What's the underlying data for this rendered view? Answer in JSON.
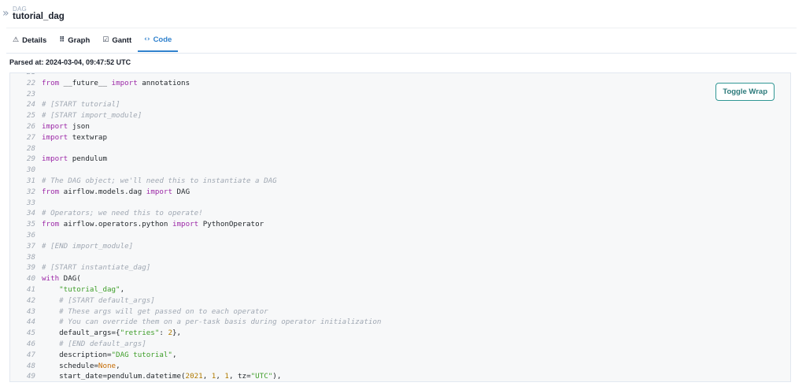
{
  "breadcrumb": {
    "type_label": "DAG",
    "title": "tutorial_dag"
  },
  "tabs": [
    {
      "icon": "⚠",
      "label": "Details",
      "active": false
    },
    {
      "icon": "⠿",
      "label": "Graph",
      "active": false
    },
    {
      "icon": "☑",
      "label": "Gantt",
      "active": false
    },
    {
      "icon": "‹›",
      "label": "Code",
      "active": true
    }
  ],
  "parsed_label": "Parsed at: 2024-03-04, 09:47:52 UTC",
  "toggle_wrap_label": "Toggle Wrap",
  "colors": {
    "accent": "#3182ce",
    "toggle": "#319795",
    "keyword": "#9d2aa8",
    "string": "#3f9e2a",
    "number": "#b07a00",
    "comment": "#a0a8b3"
  },
  "code": [
    {
      "n": "21",
      "tokens": []
    },
    {
      "n": "22",
      "tokens": [
        [
          "kw",
          "from"
        ],
        [
          "plain",
          " __future__ "
        ],
        [
          "kw",
          "import"
        ],
        [
          "plain",
          " annotations"
        ]
      ]
    },
    {
      "n": "23",
      "tokens": []
    },
    {
      "n": "24",
      "tokens": [
        [
          "comment",
          "# [START tutorial]"
        ]
      ]
    },
    {
      "n": "25",
      "tokens": [
        [
          "comment",
          "# [START import_module]"
        ]
      ]
    },
    {
      "n": "26",
      "tokens": [
        [
          "kw",
          "import"
        ],
        [
          "plain",
          " json"
        ]
      ]
    },
    {
      "n": "27",
      "tokens": [
        [
          "kw",
          "import"
        ],
        [
          "plain",
          " textwrap"
        ]
      ]
    },
    {
      "n": "28",
      "tokens": []
    },
    {
      "n": "29",
      "tokens": [
        [
          "kw",
          "import"
        ],
        [
          "plain",
          " pendulum"
        ]
      ]
    },
    {
      "n": "30",
      "tokens": []
    },
    {
      "n": "31",
      "tokens": [
        [
          "comment",
          "# The DAG object; we'll need this to instantiate a DAG"
        ]
      ]
    },
    {
      "n": "32",
      "tokens": [
        [
          "kw",
          "from"
        ],
        [
          "plain",
          " airflow.models.dag "
        ],
        [
          "kw",
          "import"
        ],
        [
          "plain",
          " DAG"
        ]
      ]
    },
    {
      "n": "33",
      "tokens": []
    },
    {
      "n": "34",
      "tokens": [
        [
          "comment",
          "# Operators; we need this to operate!"
        ]
      ]
    },
    {
      "n": "35",
      "tokens": [
        [
          "kw",
          "from"
        ],
        [
          "plain",
          " airflow.operators.python "
        ],
        [
          "kw",
          "import"
        ],
        [
          "plain",
          " PythonOperator"
        ]
      ]
    },
    {
      "n": "36",
      "tokens": []
    },
    {
      "n": "37",
      "tokens": [
        [
          "comment",
          "# [END import_module]"
        ]
      ]
    },
    {
      "n": "38",
      "tokens": []
    },
    {
      "n": "39",
      "tokens": [
        [
          "comment",
          "# [START instantiate_dag]"
        ]
      ]
    },
    {
      "n": "40",
      "tokens": [
        [
          "kw",
          "with"
        ],
        [
          "plain",
          " DAG("
        ]
      ]
    },
    {
      "n": "41",
      "tokens": [
        [
          "plain",
          "    "
        ],
        [
          "str",
          "\"tutorial_dag\""
        ],
        [
          "plain",
          ","
        ]
      ]
    },
    {
      "n": "42",
      "tokens": [
        [
          "plain",
          "    "
        ],
        [
          "comment",
          "# [START default_args]"
        ]
      ]
    },
    {
      "n": "43",
      "tokens": [
        [
          "plain",
          "    "
        ],
        [
          "comment",
          "# These args will get passed on to each operator"
        ]
      ]
    },
    {
      "n": "44",
      "tokens": [
        [
          "plain",
          "    "
        ],
        [
          "comment",
          "# You can override them on a per-task basis during operator initialization"
        ]
      ]
    },
    {
      "n": "45",
      "tokens": [
        [
          "plain",
          "    default_args={"
        ],
        [
          "str",
          "\"retries\""
        ],
        [
          "plain",
          ": "
        ],
        [
          "num",
          "2"
        ],
        [
          "plain",
          "},"
        ]
      ]
    },
    {
      "n": "46",
      "tokens": [
        [
          "plain",
          "    "
        ],
        [
          "comment",
          "# [END default_args]"
        ]
      ]
    },
    {
      "n": "47",
      "tokens": [
        [
          "plain",
          "    description="
        ],
        [
          "str",
          "\"DAG tutorial\""
        ],
        [
          "plain",
          ","
        ]
      ]
    },
    {
      "n": "48",
      "tokens": [
        [
          "plain",
          "    schedule="
        ],
        [
          "const",
          "None"
        ],
        [
          "plain",
          ","
        ]
      ]
    },
    {
      "n": "49",
      "tokens": [
        [
          "plain",
          "    start_date=pendulum.datetime("
        ],
        [
          "num",
          "2021"
        ],
        [
          "plain",
          ", "
        ],
        [
          "num",
          "1"
        ],
        [
          "plain",
          ", "
        ],
        [
          "num",
          "1"
        ],
        [
          "plain",
          ", tz="
        ],
        [
          "str",
          "\"UTC\""
        ],
        [
          "plain",
          "),"
        ]
      ]
    }
  ]
}
